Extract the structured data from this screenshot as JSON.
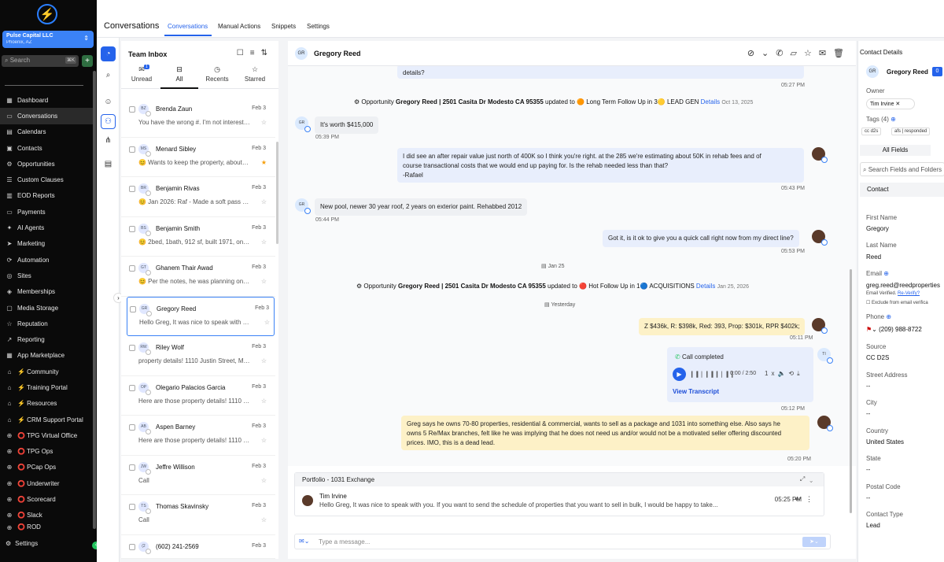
{
  "sidebar": {
    "account_name": "Pulse Capital LLC",
    "account_location": "Phoenix, AZ",
    "search_placeholder": "Search",
    "search_shortcut": "⌘K",
    "items": [
      {
        "label": "Dashboard",
        "icon": "grid-icon"
      },
      {
        "label": "Conversations",
        "icon": "chat-icon"
      },
      {
        "label": "Calendars",
        "icon": "calendar-icon"
      },
      {
        "label": "Contacts",
        "icon": "contacts-icon"
      },
      {
        "label": "Opportunities",
        "icon": "funnel-icon"
      },
      {
        "label": "Custom Clauses",
        "icon": "list-icon"
      },
      {
        "label": "EOD Reports",
        "icon": "report-icon"
      },
      {
        "label": "Payments",
        "icon": "card-icon"
      },
      {
        "label": "AI Agents",
        "icon": "sparkle-icon"
      },
      {
        "label": "Marketing",
        "icon": "send-icon"
      },
      {
        "label": "Automation",
        "icon": "automation-icon"
      },
      {
        "label": "Sites",
        "icon": "globe-icon"
      },
      {
        "label": "Memberships",
        "icon": "membership-icon"
      },
      {
        "label": "Media Storage",
        "icon": "storage-icon"
      },
      {
        "label": "Reputation",
        "icon": "star-icon"
      },
      {
        "label": "Reporting",
        "icon": "chart-icon"
      },
      {
        "label": "App Marketplace",
        "icon": "apps-icon"
      },
      {
        "label": "⚡ Community",
        "icon": "home-icon"
      },
      {
        "label": "⚡ Training Portal",
        "icon": "home-icon"
      },
      {
        "label": "⚡ Resources",
        "icon": "home-icon"
      },
      {
        "label": "⚡ CRM Support Portal",
        "icon": "home-icon"
      },
      {
        "label": "⭕ TPG Virtual Office",
        "icon": "link-icon"
      },
      {
        "label": "⭕ TPG Ops",
        "icon": "link-icon"
      },
      {
        "label": "⭕ PCap Ops",
        "icon": "link-icon"
      },
      {
        "label": "⭕ Underwriter",
        "icon": "link-icon"
      },
      {
        "label": "⭕ Scorecard",
        "icon": "link-icon"
      },
      {
        "label": "⭕ Slack",
        "icon": "link-icon"
      },
      {
        "label": "⭕ ROD",
        "icon": "link-icon"
      }
    ],
    "settings_label": "Settings"
  },
  "topbar": {
    "title": "Conversations",
    "tabs": [
      "Conversations",
      "Manual Actions",
      "Snippets",
      "Settings"
    ],
    "active_tab": "Conversations"
  },
  "inbox": {
    "title": "Team Inbox",
    "tabs": [
      {
        "label": "Unread",
        "badge": "1"
      },
      {
        "label": "All"
      },
      {
        "label": "Recents"
      },
      {
        "label": "Starred"
      }
    ],
    "active_tab": "All",
    "conversations": [
      {
        "initials": "BZ",
        "name": "Brenda Zaun",
        "date": "Feb 3",
        "preview": "You have the wrong #. I'm not interested",
        "starred": false
      },
      {
        "initials": "MS",
        "name": "Menard Sibley",
        "date": "Feb 3",
        "preview": "😊 Wants to keep the property, about to retire",
        "starred": true
      },
      {
        "initials": "BR",
        "name": "Benjamin Rivas",
        "date": "Feb 3",
        "preview": "😊 Jan 2026: Raf - Made a soft pass into",
        "starred": false
      },
      {
        "initials": "BS",
        "name": "Benjamin Smith",
        "date": "Feb 3",
        "preview": "😊 2bed, 1bath, 912 sf, built 1971, on 1 acre",
        "starred": false
      },
      {
        "initials": "GT",
        "name": "Ghanem Thair Awad",
        "date": "Feb 3",
        "preview": "😊 Per the notes, he was planning on selling",
        "starred": false
      },
      {
        "initials": "GR",
        "name": "Gregory Reed",
        "date": "Feb 3",
        "preview": "Hello Greg, It was nice to speak with you",
        "starred": false,
        "selected": true
      },
      {
        "initials": "RW",
        "name": "Riley Wolf",
        "date": "Feb 3",
        "preview": "property details! 1110 Justin Street, Modesto",
        "starred": false
      },
      {
        "initials": "OP",
        "name": "Olegario Palacios Garcia",
        "date": "Feb 3",
        "preview": "Here are those property details! 1110 Justin",
        "starred": false
      },
      {
        "initials": "AB",
        "name": "Aspen Barney",
        "date": "Feb 3",
        "preview": "Here are those property details! 1110 Justin",
        "starred": false
      },
      {
        "initials": "JW",
        "name": "Jeffre Willison",
        "date": "Feb 3",
        "preview": "Call",
        "starred": false
      },
      {
        "initials": "TS",
        "name": "Thomas Skavinsky",
        "date": "Feb 3",
        "preview": "Call",
        "starred": false
      },
      {
        "initials": "(2",
        "name": "(602) 241-2569",
        "date": "Feb 3",
        "preview": "",
        "starred": false
      }
    ]
  },
  "thread": {
    "contact_initials": "GR",
    "contact_name": "Gregory Reed",
    "messages": {
      "m0_text": "details?",
      "m0_time": "05:27 PM",
      "sys1_prefix": "Opportunity ",
      "sys1_bold": "Gregory Reed | 2501 Casita Dr Modesto CA 95355",
      "sys1_mid": " updated to 🟠 Long Term Follow Up in 3🟡 LEAD GEN ",
      "sys1_link": "Details",
      "sys1_date": "Oct 13, 2025",
      "m1_text": "It's worth $415,000",
      "m1_time": "05:39 PM",
      "m2_line1": "I did see an after repair value just north of 400K so I think you're right. at the 285 we're estimating about 50K in rehab fees and of",
      "m2_line2": "course transactional costs that we would end up paying for. Is the rehab needed less than that?",
      "m2_line3": "-Rafael",
      "m2_time": "05:43 PM",
      "m3_text": "New pool, newer 30 year roof, 2 years on exterior paint. Rehabbed 2012",
      "m3_time": "05:44 PM",
      "m4_text": "Got it, is it ok to give you a quick call right now from my direct line?",
      "m4_time": "05:53 PM",
      "day1": "Jan 25",
      "sys2_prefix": "Opportunity ",
      "sys2_bold": "Gregory Reed | 2501 Casita Dr Modesto CA 95355",
      "sys2_mid": " updated to 🔴 Hot Follow Up in 1🔵 ACQUISITIONS ",
      "sys2_link": "Details",
      "sys2_date": "Jan 25, 2026",
      "day2": "Yesterday",
      "m5_text": "Z $436k, R: $398k, Red: 393, Prop: $301k, RPR $402k;",
      "m5_time": "05:11 PM",
      "call_title": "Call completed",
      "call_progress": "0:00 / 2:50",
      "call_speed": "1x",
      "call_transcript": "View Transcript",
      "call_time": "05:12 PM",
      "m6_line1": "Greg says he owns 70-80 properties, residential & commercial, wants to sell as a package and 1031 into something else. Also says he",
      "m6_line2": "owns 5 Re/Max branches, felt like he was implying that he does not need us and/or would not be a motivated seller offering discounted",
      "m6_line3": "prices. IMO, this is a dead lead.",
      "m6_time": "05:20 PM"
    },
    "portfolio": {
      "title": "Portfolio - 1031 Exchange",
      "sender": "Tim Irvine",
      "text": "Hello Greg, It was nice to speak with you. If you want to send the schedule of properties that you want to sell in bulk, I would be happy to take...",
      "time": "05:25 PM"
    },
    "composer_placeholder": "Type a message..."
  },
  "contact": {
    "header": "Contact Details",
    "initials": "GR",
    "name": "Gregory Reed",
    "badge": "0",
    "owner_label": "Owner",
    "owner_value": "Tim Irvine",
    "tags_label": "Tags (4)",
    "tags": [
      "cc d2s",
      "afs | responded"
    ],
    "all_fields": "All Fields",
    "search_placeholder": "Search Fields and Folders",
    "section": "Contact",
    "first_name_label": "First Name",
    "first_name": "Gregory",
    "last_name_label": "Last Name",
    "last_name": "Reed",
    "email_label": "Email",
    "email": "greg.reed@reedproperties",
    "email_verified": "Email Verified.",
    "reverify": "Re-Verify?",
    "exclude": "Exclude from email verifica",
    "phone_label": "Phone",
    "phone": "(209) 988-8722",
    "source_label": "Source",
    "source": "CC D2S",
    "street_label": "Street Address",
    "street": "--",
    "city_label": "City",
    "city": "--",
    "country_label": "Country",
    "country": "United States",
    "state_label": "State",
    "state": "--",
    "postal_label": "Postal Code",
    "postal": "--",
    "type_label": "Contact Type",
    "type": "Lead"
  }
}
